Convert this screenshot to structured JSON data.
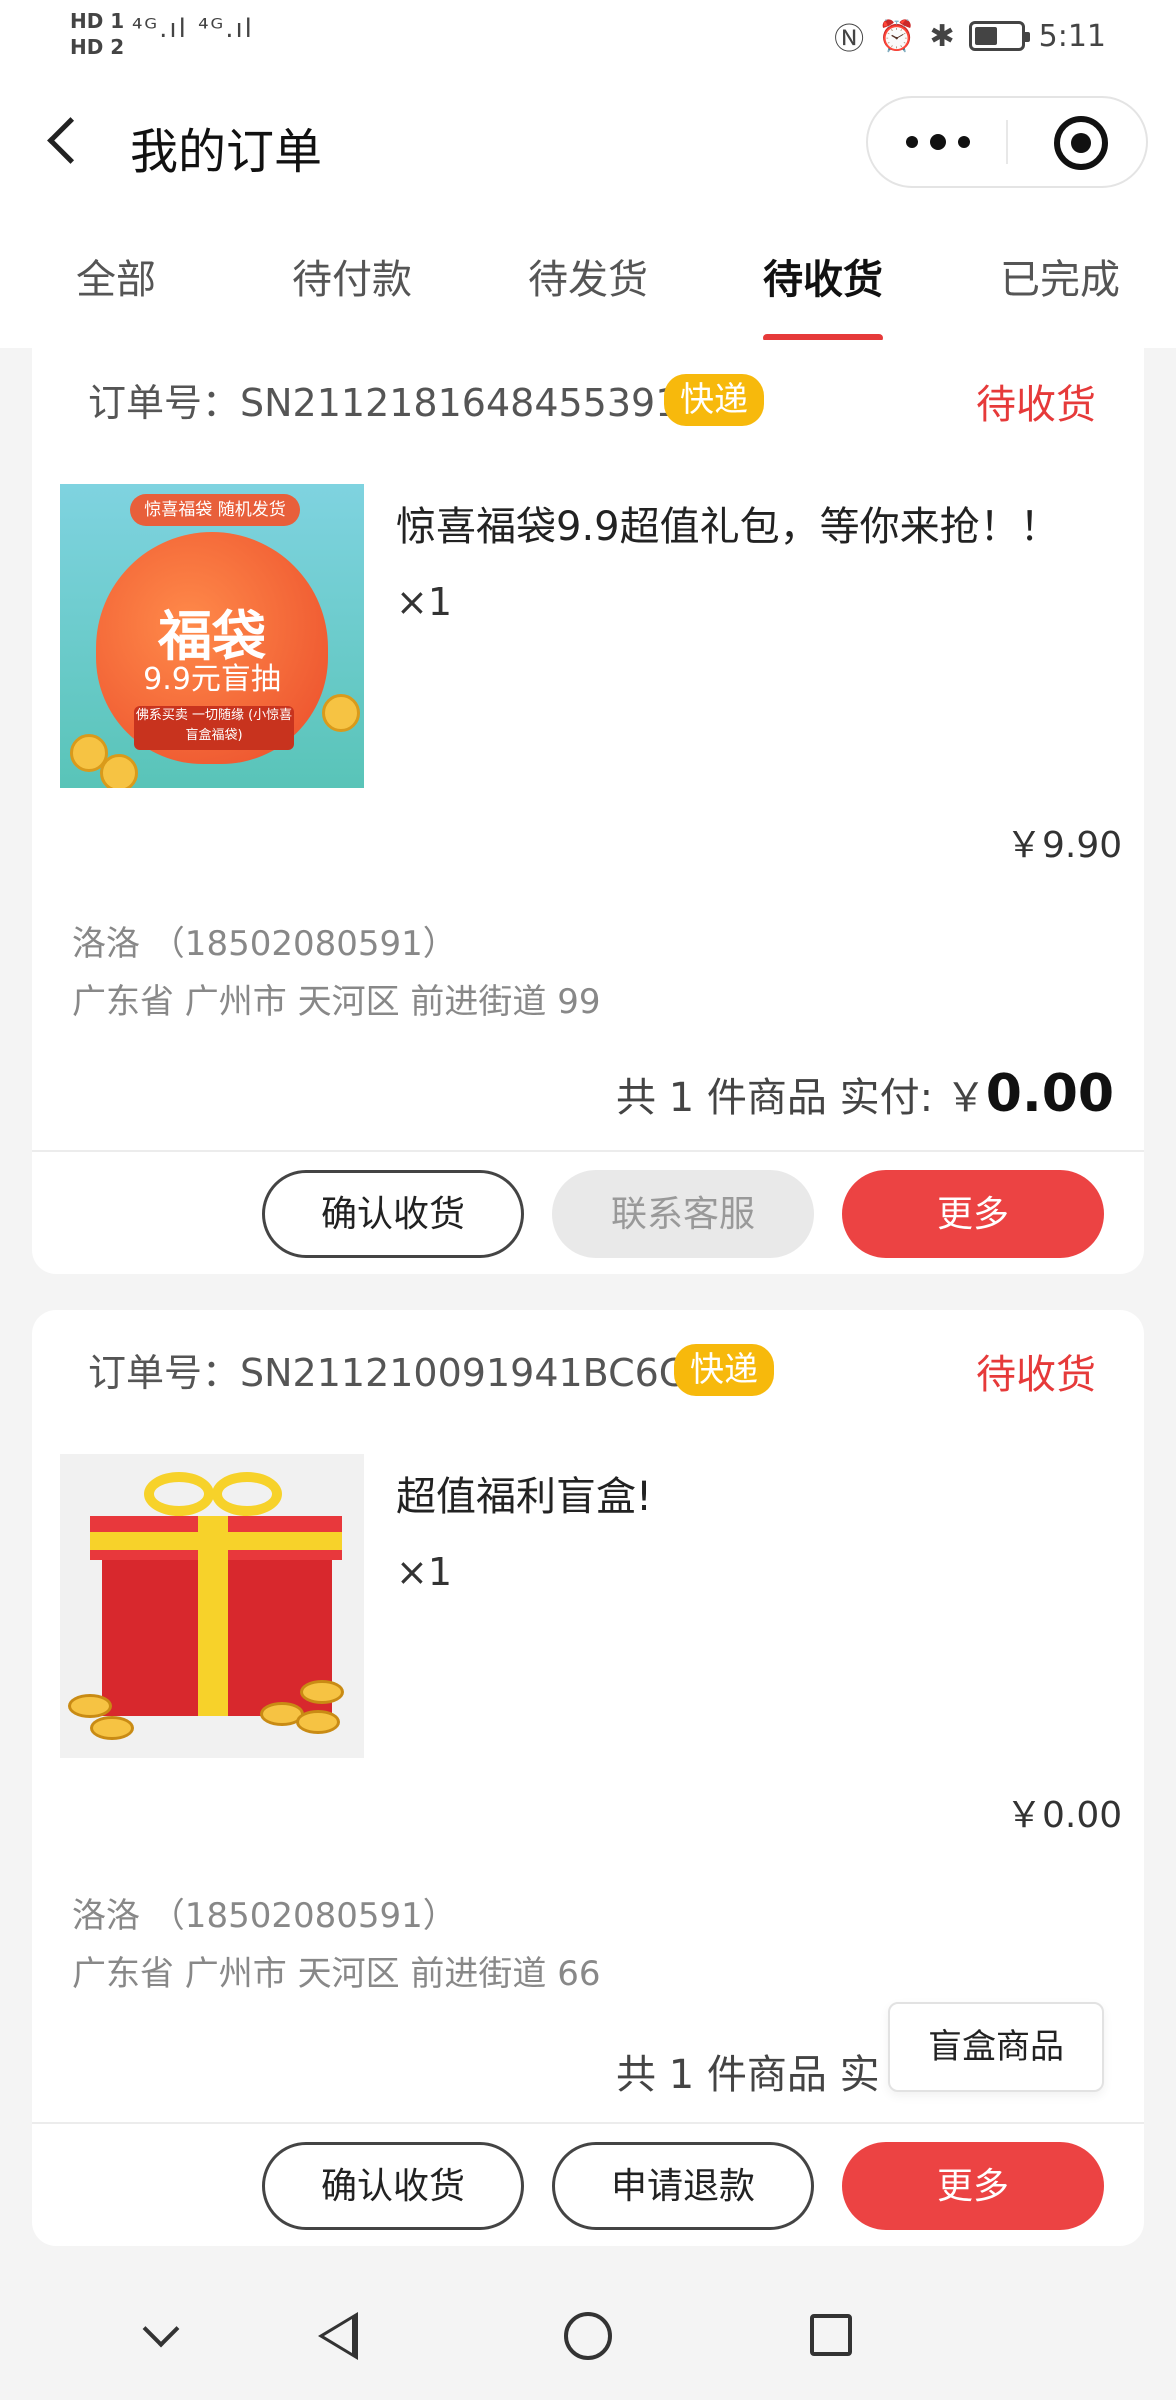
{
  "status_bar": {
    "hd1": "HD 1",
    "hd2": "HD 2",
    "signal": "⁴ᴳ.ıl ⁴ᴳ.ıl",
    "icons": [
      "nfc-icon",
      "alarm-icon",
      "bluetooth-icon",
      "battery-icon"
    ],
    "time": "5:11"
  },
  "header": {
    "title": "我的订单",
    "more_icon": "more-dots-icon",
    "target_icon": "target-icon"
  },
  "tabs": [
    {
      "label": "全部",
      "active": false
    },
    {
      "label": "待付款",
      "active": false
    },
    {
      "label": "待发货",
      "active": false
    },
    {
      "label": "待收货",
      "active": true
    },
    {
      "label": "已完成",
      "active": false
    }
  ],
  "orders": [
    {
      "order_no": "订单号：SN2112181648455391",
      "badge": "快递",
      "status": "待收货",
      "image": {
        "top": "惊喜福袋 随机发货",
        "big": "福袋",
        "mid": "9.9元盲抽",
        "small": "佛系买卖 一切随缘 (小惊喜盲盒福袋)"
      },
      "product_title": "惊喜福袋9.9超值礼包，等你来抢！！",
      "qty": "×1",
      "price": "￥9.90",
      "contact": "洛洛 （18502080591）",
      "address": "广东省 广州市 天河区 前进街道 99",
      "summary_prefix": "共 1 件商品  实付: ￥",
      "summary_amount": "0.00",
      "buttons": [
        "确认收货",
        "联系客服",
        "更多"
      ]
    },
    {
      "order_no": "订单号：SN211210091941BC6C",
      "badge": "快递",
      "status": "待收货",
      "product_title": "超值福利盲盒!",
      "qty": "×1",
      "price": "￥0.00",
      "contact": "洛洛 （18502080591）",
      "address": "广东省 广州市 天河区 前进街道 66",
      "summary_prefix": "共 1 件商品  实",
      "buttons": [
        "确认收货",
        "申请退款",
        "更多"
      ]
    }
  ],
  "tooltip": "盲盒商品",
  "colors": {
    "accent_red": "#ec4343",
    "status_red": "#e63a3a",
    "badge_yellow": "#f7b90c"
  }
}
